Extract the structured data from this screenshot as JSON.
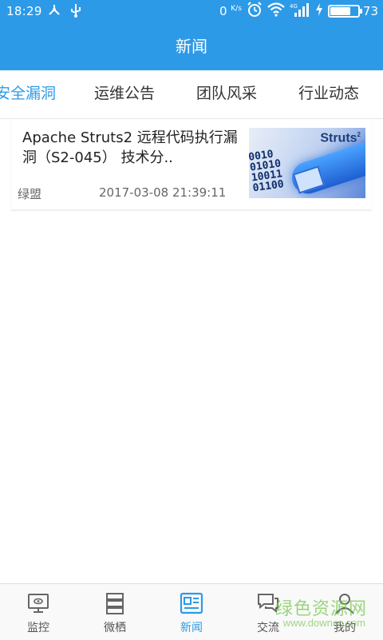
{
  "status_bar": {
    "time": "18:29",
    "net_speed": "0",
    "net_unit": "K/s",
    "network": "4G",
    "battery_percent": "73",
    "battery_level": 0.73
  },
  "app_bar": {
    "title": "新闻"
  },
  "tabs": [
    {
      "label": "安全漏洞",
      "active": true
    },
    {
      "label": "运维公告",
      "active": false
    },
    {
      "label": "团队风采",
      "active": false
    },
    {
      "label": "行业动态",
      "active": false
    }
  ],
  "news": [
    {
      "title": "Apache Struts2  远程代码执行漏洞（S2-045） 技术分..",
      "source": "绿盟",
      "date": "2017-03-08 21:39:11",
      "thumb_brand": "Struts",
      "thumb_brand_sup": "2",
      "thumb_bits": "0010\n01010\n10011\n01100"
    }
  ],
  "bottom_nav": [
    {
      "label": "监控",
      "icon": "monitor-icon",
      "active": false
    },
    {
      "label": "微栖",
      "icon": "server-stack-icon",
      "active": false
    },
    {
      "label": "新闻",
      "icon": "news-icon",
      "active": true
    },
    {
      "label": "交流",
      "icon": "chat-icon",
      "active": false
    },
    {
      "label": "我的",
      "icon": "user-icon",
      "active": false
    }
  ],
  "watermark": {
    "text": "绿色资源网",
    "sub": "www.downcc.com"
  },
  "colors": {
    "primary": "#2d9ae8",
    "text": "#333333",
    "muted": "#666666"
  }
}
